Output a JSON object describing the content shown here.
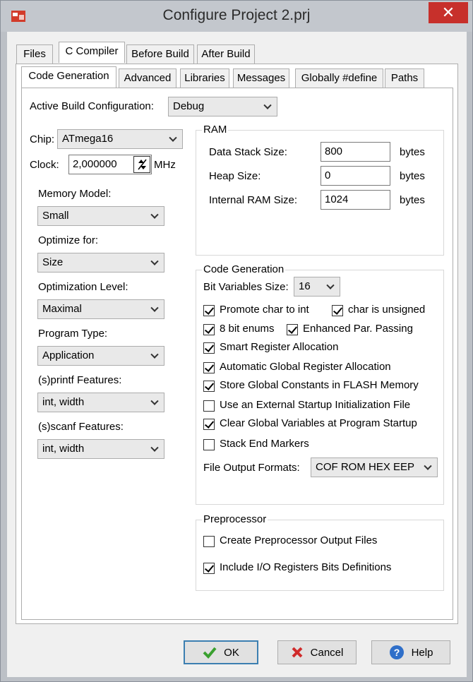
{
  "window": {
    "title": "Configure Project 2.prj",
    "close_glyph": "✕"
  },
  "outer_tabs": [
    "Files",
    "C Compiler",
    "Before Build",
    "After Build"
  ],
  "inner_tabs": [
    "Code Generation",
    "Advanced",
    "Libraries",
    "Messages",
    "Globally #define",
    "Paths"
  ],
  "active_build": {
    "label": "Active Build Configuration:",
    "value": "Debug"
  },
  "chip": {
    "label": "Chip:",
    "value": "ATmega16"
  },
  "clock": {
    "label": "Clock:",
    "value": "2,000000",
    "unit": "MHz"
  },
  "left_fields": [
    {
      "label": "Memory Model:",
      "value": "Small"
    },
    {
      "label": "Optimize for:",
      "value": "Size"
    },
    {
      "label": "Optimization Level:",
      "value": "Maximal"
    },
    {
      "label": "Program Type:",
      "value": "Application"
    },
    {
      "label": "(s)printf Features:",
      "value": "int, width"
    },
    {
      "label": "(s)scanf Features:",
      "value": "int, width"
    }
  ],
  "ram": {
    "title": "RAM",
    "rows": [
      {
        "label": "Data Stack Size:",
        "value": "800",
        "unit": "bytes"
      },
      {
        "label": "Heap Size:",
        "value": "0",
        "unit": "bytes"
      },
      {
        "label": "Internal RAM Size:",
        "value": "1024",
        "unit": "bytes"
      }
    ]
  },
  "code_gen": {
    "title": "Code Generation",
    "bit_vars_label": "Bit Variables Size:",
    "bit_vars_value": "16",
    "checks": [
      {
        "label": "Promote char to int",
        "checked": true
      },
      {
        "label": "char is unsigned",
        "checked": true
      },
      {
        "label": "8 bit enums",
        "checked": true
      },
      {
        "label": "Enhanced Par. Passing",
        "checked": true
      },
      {
        "label": "Smart Register Allocation",
        "checked": true
      },
      {
        "label": "Automatic Global Register Allocation",
        "checked": true
      },
      {
        "label": "Store Global Constants in FLASH Memory",
        "checked": true
      },
      {
        "label": "Use an External Startup Initialization File",
        "checked": false
      },
      {
        "label": "Clear Global Variables at Program Startup",
        "checked": true
      },
      {
        "label": "Stack End Markers",
        "checked": false
      }
    ],
    "output_label": "File Output Formats:",
    "output_value": "COF ROM HEX EEP"
  },
  "preprocessor": {
    "title": "Preprocessor",
    "checks": [
      {
        "label": "Create Preprocessor Output Files",
        "checked": false
      },
      {
        "label": "Include I/O Registers Bits Definitions",
        "checked": true
      }
    ]
  },
  "buttons": {
    "ok": "OK",
    "cancel": "Cancel",
    "help": "Help"
  },
  "colors": {
    "close": "#c7302b",
    "ok_check": "#3aa02f",
    "cancel_x": "#d02b2b",
    "help_circle": "#2f6fc9"
  }
}
